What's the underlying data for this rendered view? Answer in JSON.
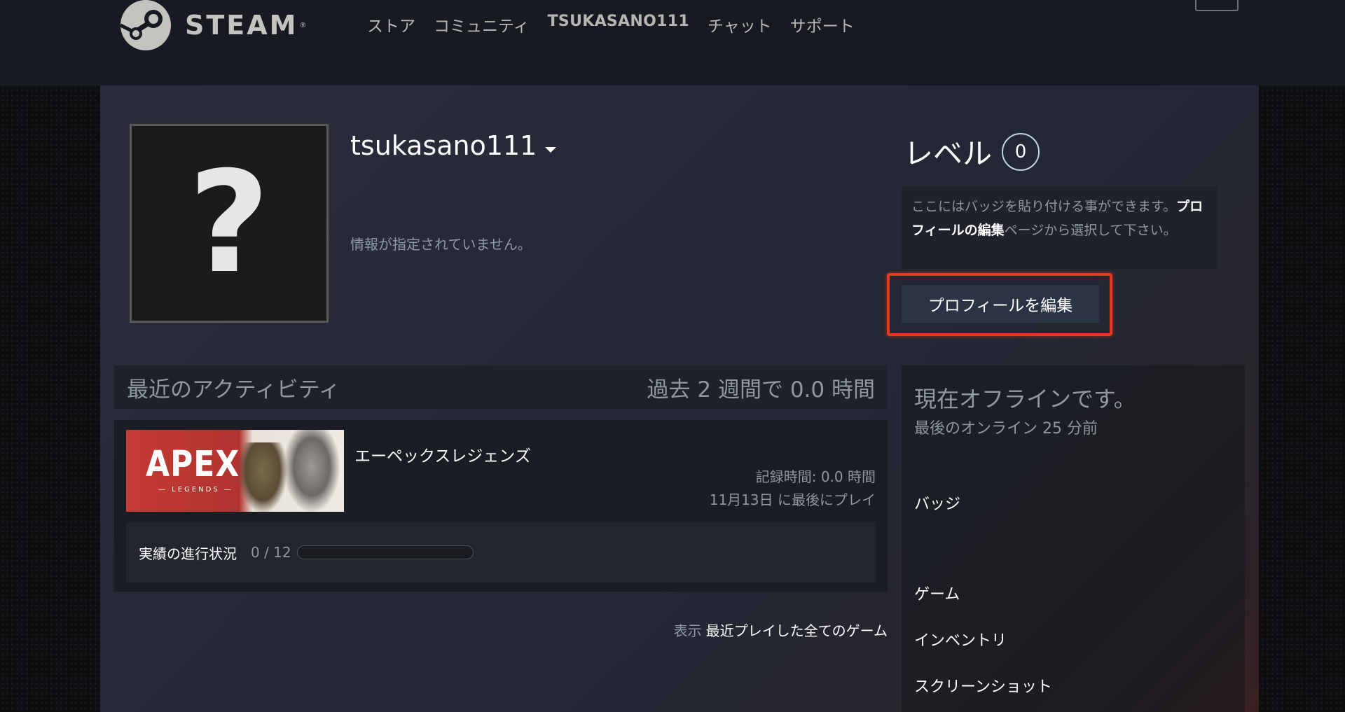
{
  "header": {
    "logo_text": "STEAM",
    "logo_reg": "®",
    "nav": [
      "ストア",
      "コミュニティ",
      "TSUKASANO111",
      "チャット",
      "サポート"
    ]
  },
  "profile": {
    "avatar_placeholder": "?",
    "persona_name": "tsukasano111",
    "summary": "情報が指定されていません。",
    "level_label": "レベル",
    "level_value": "0",
    "badge_note_pre": "ここにはバッジを貼り付ける事ができます。",
    "badge_note_link": "プロフィールの編集",
    "badge_note_post": "ページから選択して下さい。",
    "edit_button": "プロフィールを編集"
  },
  "activity": {
    "title": "最近のアクティビティ",
    "hours_summary": "過去 2 週間で 0.0 時間",
    "game": {
      "capsule_title": "APEX",
      "capsule_subtitle": "— LEGENDS —",
      "name": "エーペックスレジェンズ",
      "hours_on_record": "記録時間: 0.0 時間",
      "last_played": "11月13日 に最後にプレイ",
      "achievements_label": "実績の進行状況",
      "achievements_count": "0 / 12",
      "achievements_progress": 0
    },
    "show_label": "表示",
    "show_all_link": "最近プレイした全てのゲーム"
  },
  "sidebar": {
    "status": "現在オフラインです。",
    "last_online": "最後のオンライン 25 分前",
    "links": [
      "バッジ",
      "ゲーム",
      "インベントリ",
      "スクリーンショット"
    ]
  }
}
